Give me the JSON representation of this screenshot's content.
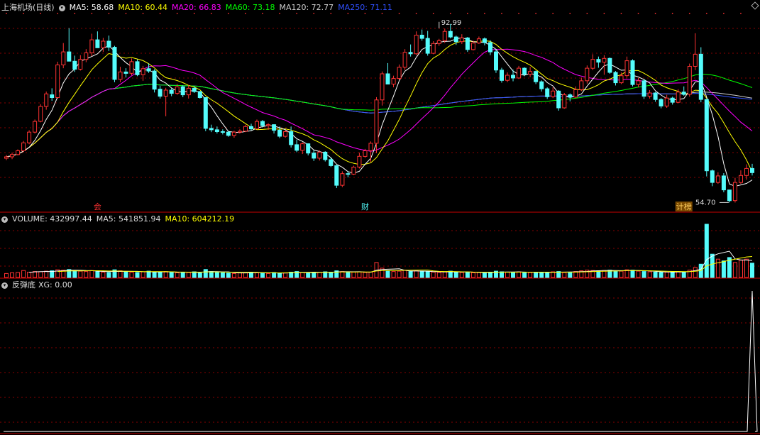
{
  "colors": {
    "up": "#ff3232",
    "down": "#54fcfc",
    "grid": "#8a0000",
    "divider": "#c80000",
    "ma5": "#ffffff",
    "ma10": "#ffff00",
    "ma20": "#ff00ff",
    "ma60": "#00ff00",
    "ma120": "#cccccc",
    "ma250": "#3050ff"
  },
  "header": {
    "title": "上海机场(日线)",
    "ma5": "MA5: 58.68",
    "ma10": "MA10: 60.44",
    "ma20": "MA20: 66.83",
    "ma60": "MA60: 73.18",
    "ma120": "MA120: 72.77",
    "ma250": "MA250: 71.11"
  },
  "volume_header": {
    "volume": "VOLUME: 432997.44",
    "ma5": "MA5: 541851.94",
    "ma10": "MA10: 604212.19"
  },
  "indicator_header": {
    "name": "反弹底",
    "xg": "XG: 0.00"
  },
  "markers": {
    "left": "会",
    "mid": "财",
    "right": "计榜"
  },
  "chart_data": {
    "type": "candlestick",
    "price_annotations": {
      "high": "92.99",
      "low": "54.70"
    },
    "ohlc": [
      [
        64.2,
        64.9,
        63.8,
        64.5
      ],
      [
        64.5,
        65.4,
        64.0,
        65.0
      ],
      [
        65.0,
        66.1,
        64.8,
        65.8
      ],
      [
        65.8,
        67.9,
        65.5,
        67.5
      ],
      [
        67.5,
        70.2,
        67.2,
        69.8
      ],
      [
        69.8,
        72.5,
        69.5,
        72.1
      ],
      [
        72.1,
        75.8,
        71.9,
        75.3
      ],
      [
        75.3,
        78.5,
        74.6,
        78.0
      ],
      [
        77.8,
        79.2,
        76.5,
        77.2
      ],
      [
        77.2,
        84.9,
        77.0,
        84.2
      ],
      [
        84.2,
        88.9,
        83.5,
        87.0
      ],
      [
        87.0,
        92.1,
        86.6,
        85.0
      ],
      [
        85.0,
        86.2,
        82.7,
        83.3
      ],
      [
        83.3,
        86.3,
        83.0,
        85.4
      ],
      [
        85.4,
        87.6,
        84.8,
        86.8
      ],
      [
        86.8,
        90.9,
        86.1,
        89.6
      ],
      [
        89.6,
        91.4,
        88.5,
        87.9
      ],
      [
        87.9,
        90.0,
        87.0,
        89.3
      ],
      [
        89.3,
        90.5,
        87.2,
        88.0
      ],
      [
        88.0,
        88.3,
        80.5,
        81.1
      ],
      [
        81.1,
        83.8,
        80.5,
        82.7
      ],
      [
        82.7,
        83.5,
        81.5,
        82.4
      ],
      [
        82.4,
        85.6,
        82.0,
        84.9
      ],
      [
        84.9,
        85.4,
        81.8,
        82.1
      ],
      [
        82.1,
        84.0,
        80.8,
        83.4
      ],
      [
        83.4,
        84.5,
        82.5,
        82.9
      ],
      [
        82.9,
        83.3,
        78.3,
        79.0
      ],
      [
        79.0,
        79.7,
        77.0,
        77.5
      ],
      [
        77.5,
        79.3,
        73.2,
        78.8
      ],
      [
        78.8,
        79.2,
        77.5,
        78.1
      ],
      [
        78.1,
        80.1,
        77.8,
        79.5
      ],
      [
        79.5,
        79.8,
        77.3,
        77.8
      ],
      [
        77.8,
        79.9,
        77.0,
        79.2
      ],
      [
        79.2,
        79.6,
        78.2,
        78.5
      ],
      [
        78.5,
        78.6,
        77.0,
        77.2
      ],
      [
        77.2,
        73.4,
        70.0,
        70.6
      ],
      [
        70.6,
        71.4,
        69.8,
        70.3
      ],
      [
        70.3,
        71.0,
        69.5,
        69.9
      ],
      [
        69.9,
        70.4,
        69.3,
        69.8
      ],
      [
        69.8,
        70.0,
        68.8,
        69.1
      ],
      [
        69.1,
        70.1,
        68.6,
        69.8
      ],
      [
        69.8,
        70.4,
        69.5,
        70.0
      ],
      [
        70.0,
        71.4,
        69.8,
        71.0
      ],
      [
        71.0,
        71.6,
        70.2,
        70.5
      ],
      [
        70.5,
        72.5,
        70.4,
        72.1
      ],
      [
        72.1,
        72.4,
        70.8,
        71.2
      ],
      [
        71.2,
        71.7,
        70.3,
        71.4
      ],
      [
        71.4,
        71.5,
        69.5,
        70.2
      ],
      [
        70.2,
        71.0,
        68.5,
        68.9
      ],
      [
        68.9,
        70.2,
        68.6,
        69.9
      ],
      [
        69.9,
        71.0,
        66.5,
        67.1
      ],
      [
        67.1,
        68.2,
        65.5,
        65.9
      ],
      [
        65.9,
        67.6,
        65.1,
        67.3
      ],
      [
        67.3,
        67.4,
        64.8,
        65.3
      ],
      [
        65.3,
        65.9,
        63.6,
        64.2
      ],
      [
        64.2,
        65.9,
        63.7,
        65.5
      ],
      [
        65.5,
        65.7,
        63.5,
        63.9
      ],
      [
        63.9,
        64.4,
        62.3,
        62.6
      ],
      [
        62.6,
        62.8,
        57.8,
        58.4
      ],
      [
        58.4,
        61.4,
        58.0,
        60.9
      ],
      [
        60.9,
        61.4,
        60.1,
        60.8
      ],
      [
        60.8,
        62.6,
        60.6,
        62.3
      ],
      [
        62.3,
        65.4,
        62.0,
        64.6
      ],
      [
        64.6,
        66.2,
        64.3,
        65.8
      ],
      [
        65.8,
        67.8,
        63.4,
        67.4
      ],
      [
        67.4,
        77.3,
        65.3,
        76.7
      ],
      [
        76.7,
        82.8,
        75.5,
        82.3
      ],
      [
        82.3,
        84.6,
        82.0,
        80.1
      ],
      [
        80.1,
        81.9,
        79.4,
        81.3
      ],
      [
        81.3,
        84.3,
        81.0,
        83.7
      ],
      [
        83.7,
        87.6,
        83.1,
        86.9
      ],
      [
        86.9,
        88.6,
        86.0,
        86.6
      ],
      [
        86.6,
        91.4,
        86.3,
        90.6
      ],
      [
        90.6,
        91.8,
        89.4,
        89.9
      ],
      [
        89.9,
        91.5,
        86.2,
        86.7
      ],
      [
        86.7,
        89.3,
        86.5,
        88.8
      ],
      [
        88.8,
        89.8,
        88.3,
        89.4
      ],
      [
        89.4,
        92.0,
        88.9,
        91.4
      ],
      [
        91.4,
        92.99,
        89.9,
        90.2
      ],
      [
        90.2,
        90.5,
        88.5,
        89.2
      ],
      [
        89.2,
        90.8,
        88.7,
        90.0
      ],
      [
        90.0,
        90.2,
        87.0,
        87.5
      ],
      [
        87.5,
        89.4,
        87.3,
        88.9
      ],
      [
        88.9,
        90.3,
        88.7,
        89.8
      ],
      [
        89.8,
        90.1,
        88.4,
        89.0
      ],
      [
        89.0,
        89.5,
        86.3,
        87.0
      ],
      [
        87.0,
        87.5,
        82.5,
        83.1
      ],
      [
        83.1,
        83.6,
        80.4,
        80.9
      ],
      [
        80.9,
        82.6,
        80.5,
        82.0
      ],
      [
        82.0,
        83.2,
        80.7,
        81.4
      ],
      [
        81.4,
        84.0,
        81.2,
        83.5
      ],
      [
        83.5,
        83.7,
        81.8,
        82.2
      ],
      [
        82.2,
        83.8,
        81.6,
        82.8
      ],
      [
        82.8,
        83.0,
        80.1,
        80.6
      ],
      [
        80.6,
        80.9,
        78.5,
        79.1
      ],
      [
        79.1,
        79.4,
        76.9,
        77.4
      ],
      [
        77.4,
        79.4,
        77.1,
        78.6
      ],
      [
        78.6,
        78.8,
        74.4,
        75.0
      ],
      [
        75.0,
        78.2,
        74.8,
        77.8
      ],
      [
        77.8,
        78.1,
        76.4,
        77.3
      ],
      [
        77.3,
        79.6,
        77.1,
        78.9
      ],
      [
        78.9,
        81.5,
        78.6,
        80.8
      ],
      [
        80.8,
        84.1,
        80.2,
        83.5
      ],
      [
        83.5,
        86.5,
        83.1,
        85.4
      ],
      [
        85.4,
        86.0,
        83.6,
        84.8
      ],
      [
        84.8,
        86.3,
        82.1,
        85.6
      ],
      [
        85.6,
        85.8,
        82.3,
        82.6
      ],
      [
        82.6,
        82.9,
        79.8,
        80.4
      ],
      [
        80.4,
        82.6,
        80.1,
        81.9
      ],
      [
        81.9,
        86.0,
        81.5,
        85.1
      ],
      [
        85.1,
        85.4,
        79.6,
        80.0
      ],
      [
        80.0,
        81.4,
        79.4,
        80.8
      ],
      [
        80.8,
        81.2,
        76.9,
        77.5
      ],
      [
        77.5,
        78.8,
        77.0,
        78.2
      ],
      [
        78.2,
        78.4,
        76.3,
        76.8
      ],
      [
        76.8,
        77.1,
        74.9,
        75.4
      ],
      [
        75.4,
        77.8,
        75.0,
        77.1
      ],
      [
        77.1,
        77.4,
        75.7,
        76.2
      ],
      [
        76.2,
        79.0,
        76.0,
        78.4
      ],
      [
        78.4,
        79.6,
        77.6,
        77.9
      ],
      [
        77.9,
        84.5,
        77.4,
        83.9
      ],
      [
        83.9,
        91.0,
        83.1,
        86.5
      ],
      [
        86.5,
        88.0,
        76.2,
        76.8
      ],
      [
        76.8,
        76.8,
        60.3,
        61.5
      ],
      [
        61.5,
        61.8,
        58.2,
        59.0
      ],
      [
        59.0,
        61.2,
        58.7,
        60.4
      ],
      [
        60.4,
        61.0,
        56.9,
        57.4
      ],
      [
        57.4,
        57.4,
        54.7,
        55.1
      ],
      [
        55.1,
        60.0,
        54.7,
        59.0
      ],
      [
        59.0,
        61.6,
        58.7,
        60.5
      ],
      [
        60.5,
        62.9,
        59.6,
        62.0
      ],
      [
        62.0,
        63.0,
        60.5,
        61.1
      ]
    ],
    "volume": [
      1.2,
      1.4,
      1.5,
      2.1,
      1.6,
      1.8,
      1.7,
      1.9,
      2.0,
      2.3,
      2.2,
      2.4,
      2.0,
      1.9,
      1.8,
      2.1,
      1.7,
      1.6,
      1.5,
      2.3,
      2.0,
      1.8,
      1.6,
      1.5,
      1.7,
      1.9,
      1.6,
      1.5,
      1.8,
      1.6,
      1.4,
      1.6,
      1.5,
      1.7,
      1.3,
      2.4,
      1.8,
      1.5,
      1.4,
      1.3,
      1.2,
      1.4,
      1.5,
      1.6,
      1.4,
      1.3,
      1.2,
      1.5,
      1.3,
      1.4,
      1.6,
      1.8,
      1.5,
      1.4,
      1.6,
      1.5,
      1.7,
      1.6,
      2.0,
      1.8,
      1.5,
      1.6,
      1.7,
      1.5,
      1.6,
      4.5,
      2.8,
      2.0,
      1.8,
      1.9,
      2.2,
      1.8,
      2.0,
      1.7,
      1.8,
      1.6,
      1.5,
      1.7,
      1.9,
      1.6,
      1.5,
      1.6,
      1.4,
      1.5,
      1.4,
      1.6,
      1.9,
      1.7,
      1.6,
      1.5,
      1.7,
      1.6,
      1.5,
      1.4,
      1.5,
      1.6,
      1.7,
      1.8,
      1.5,
      1.6,
      1.8,
      2.0,
      2.2,
      2.1,
      2.0,
      2.1,
      2.2,
      2.0,
      1.9,
      2.3,
      2.2,
      1.9,
      1.8,
      1.7,
      1.6,
      1.5,
      1.6,
      1.7,
      1.8,
      1.6,
      2.2,
      3.0,
      4.0,
      16.0,
      7.0,
      5.5,
      5.0,
      6.0,
      4.5,
      5.2,
      5.5,
      4.3
    ],
    "xg_signal_index": 131,
    "ylim": [
      54.0,
      96.0
    ]
  }
}
